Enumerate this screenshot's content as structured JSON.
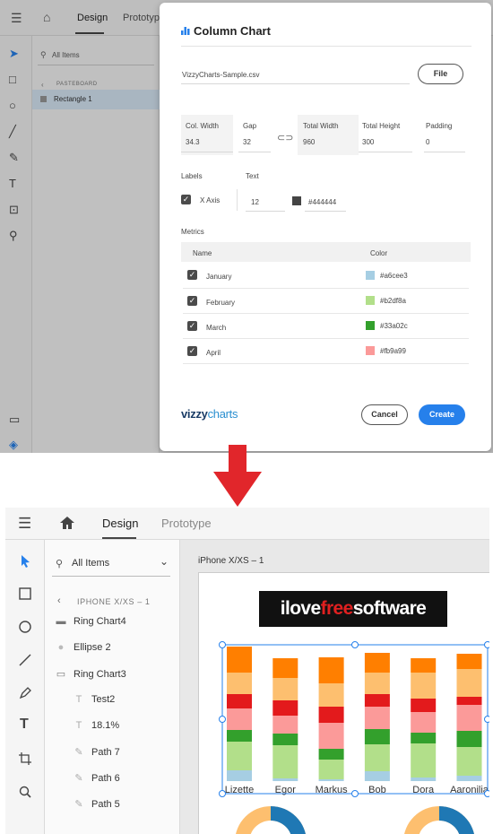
{
  "top": {
    "tabs": {
      "design": "Design",
      "prototype": "Prototype"
    },
    "search": {
      "placeholder": "All Items"
    },
    "pasteboard": "PASTEBOARD",
    "layer": "Rectangle 1"
  },
  "dialog": {
    "title": "Column Chart",
    "file_name": "VizzyCharts-Sample.csv",
    "file_button": "File",
    "dims": {
      "col_width": {
        "label": "Col. Width",
        "value": "34.3"
      },
      "gap": {
        "label": "Gap",
        "value": "32"
      },
      "total_width": {
        "label": "Total Width",
        "value": "960"
      },
      "total_height": {
        "label": "Total Height",
        "value": "300"
      },
      "padding": {
        "label": "Padding",
        "value": "0"
      }
    },
    "labels_heading": "Labels",
    "text_heading": "Text",
    "x_axis_label": "X Axis",
    "text_size": "12",
    "text_color": "#444444",
    "metrics_heading": "Metrics",
    "col_name": "Name",
    "col_color": "Color",
    "metrics": [
      {
        "name": "January",
        "color": "#a6cee3"
      },
      {
        "name": "February",
        "color": "#b2df8a"
      },
      {
        "name": "March",
        "color": "#33a02c"
      },
      {
        "name": "April",
        "color": "#fb9a99"
      }
    ],
    "brand": {
      "a": "vizzy",
      "b": "charts"
    },
    "cancel": "Cancel",
    "create": "Create"
  },
  "bottom": {
    "tabs": {
      "design": "Design",
      "prototype": "Prototype"
    },
    "search": {
      "placeholder": "All Items"
    },
    "breadcrumb": "IPHONE X/XS – 1",
    "layers": [
      {
        "name": "Ring Chart4",
        "icon": "folder-icon",
        "indent": 0
      },
      {
        "name": "Ellipse 2",
        "icon": "ellipse-icon",
        "indent": 0
      },
      {
        "name": "Ring Chart3",
        "icon": "folder-outline-icon",
        "indent": 0
      },
      {
        "name": "Test2",
        "icon": "text-icon",
        "indent": 1
      },
      {
        "name": "18.1%",
        "icon": "text-icon",
        "indent": 1
      },
      {
        "name": "Path 7",
        "icon": "pen-icon",
        "indent": 1
      },
      {
        "name": "Path 6",
        "icon": "pen-icon",
        "indent": 1
      },
      {
        "name": "Path 5",
        "icon": "pen-icon",
        "indent": 1
      }
    ],
    "artboard_title": "iPhone X/XS – 1",
    "logo": {
      "a": "ilove",
      "b": "free",
      "c": "software"
    }
  },
  "chart_data": {
    "type": "bar",
    "stacked": true,
    "categories": [
      "Lizette",
      "Egor",
      "Markus",
      "Bob",
      "Dora",
      "Aaronilia"
    ],
    "series": [
      {
        "color": "#a6cee3",
        "values": [
          12,
          3,
          2,
          11,
          4,
          6
        ]
      },
      {
        "color": "#b2df8a",
        "values": [
          32,
          37,
          22,
          30,
          38,
          32
        ]
      },
      {
        "color": "#33a02c",
        "values": [
          13,
          13,
          12,
          17,
          12,
          18
        ]
      },
      {
        "color": "#fb9a99",
        "values": [
          24,
          20,
          29,
          25,
          23,
          29
        ]
      },
      {
        "color": "#e31a1c",
        "values": [
          16,
          17,
          18,
          14,
          15,
          9
        ]
      },
      {
        "color": "#fdbf6f",
        "values": [
          24,
          25,
          26,
          24,
          29,
          31
        ]
      },
      {
        "color": "#ff7f00",
        "values": [
          29,
          22,
          29,
          22,
          16,
          17
        ]
      }
    ]
  }
}
